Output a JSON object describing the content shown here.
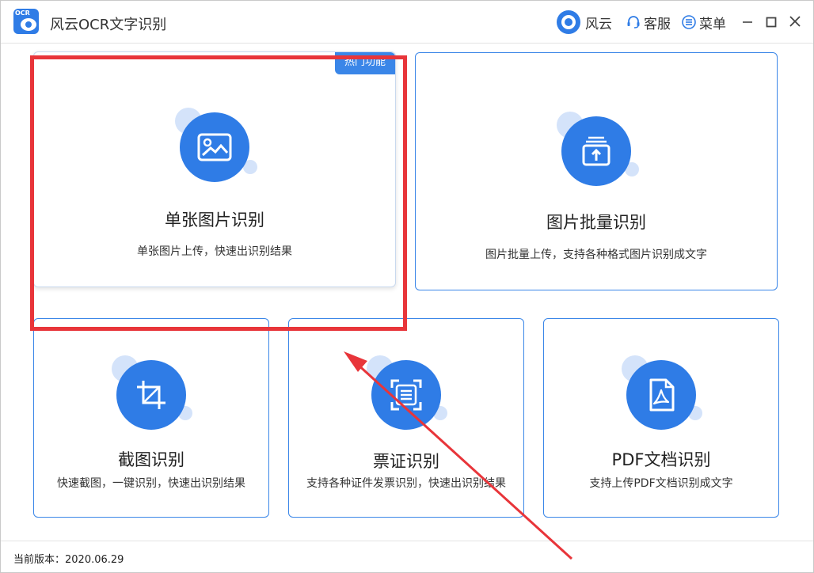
{
  "window": {
    "title": "风云OCR文字识别",
    "logo_text": "OCR"
  },
  "titlebar": {
    "fengyun_label": "风云",
    "kefu_label": "客服",
    "menu_label": "菜单"
  },
  "cards": {
    "single": {
      "title": "单张图片识别",
      "desc": "单张图片上传，快速出识别结果",
      "badge": "热门功能",
      "icon": "image-icon"
    },
    "batch": {
      "title": "图片批量识别",
      "desc": "图片批量上传，支持各种格式图片识别成文字",
      "icon": "upload-stack-icon"
    },
    "screenshot": {
      "title": "截图识别",
      "desc": "快速截图，一键识别，快速出识别结果",
      "icon": "crop-icon"
    },
    "ticket": {
      "title": "票证识别",
      "desc": "支持各种证件发票识别，快速出识别结果",
      "icon": "scan-document-icon"
    },
    "pdf": {
      "title": "PDF文档识别",
      "desc": "支持上传PDF文档识别成文字",
      "icon": "pdf-icon"
    }
  },
  "statusbar": {
    "version": "当前版本：2020.06.29"
  },
  "colors": {
    "accent": "#2f7ce6",
    "annotation": "#e8353a",
    "bubble": "#d4e3fa"
  }
}
